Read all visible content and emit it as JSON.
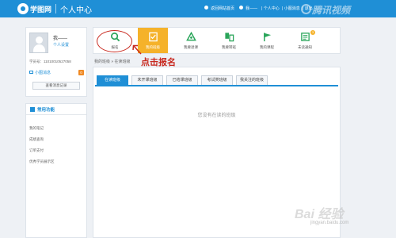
{
  "header": {
    "logo_text": "学图网",
    "title": "个人中心",
    "links": [
      "返回网站首页",
      "我——",
      "| 个人中心",
      "| 小图消息",
      "| 退出"
    ],
    "icons": [
      "home-icon",
      "user-icon"
    ]
  },
  "profile": {
    "name": "我——",
    "settings_link": "个人设置",
    "student_id": "学员号：11010010527058",
    "message_label": "小图消息",
    "message_count": "0",
    "view_history_button": "查看消息记录"
  },
  "functions": {
    "title": "常用功能",
    "items": [
      "我的笔记",
      "成绩查询",
      "订单支付",
      "优秀学员展示区"
    ]
  },
  "nav": {
    "items": [
      {
        "label": "报名",
        "icon": "search-icon"
      },
      {
        "label": "我的班级",
        "icon": "clipboard-icon",
        "active": true
      },
      {
        "label": "我要退课",
        "icon": "recycle-icon"
      },
      {
        "label": "我要转班",
        "icon": "transfer-icon"
      },
      {
        "label": "我的课程",
        "icon": "flag-icon"
      },
      {
        "label": "未读通知",
        "icon": "notice-icon",
        "badge": "3"
      }
    ],
    "active_color": "#f5b22a"
  },
  "annotation": {
    "text": "点击报名",
    "color": "#c8281e"
  },
  "breadcrumb": "我的班级 » 在读班级",
  "tabs": [
    "在读班级",
    "未开课班级",
    "已结课班级",
    "考试类班级",
    "我关注的班级"
  ],
  "active_tab": 0,
  "empty_text": "您没有在读的班级",
  "watermarks": {
    "tencent": "腾讯视频",
    "baidu": "Bai 经验",
    "baidu_url": "jingyan.baidu.com"
  },
  "colors": {
    "brand": "#1f8fd6",
    "background": "#eef1f5"
  }
}
